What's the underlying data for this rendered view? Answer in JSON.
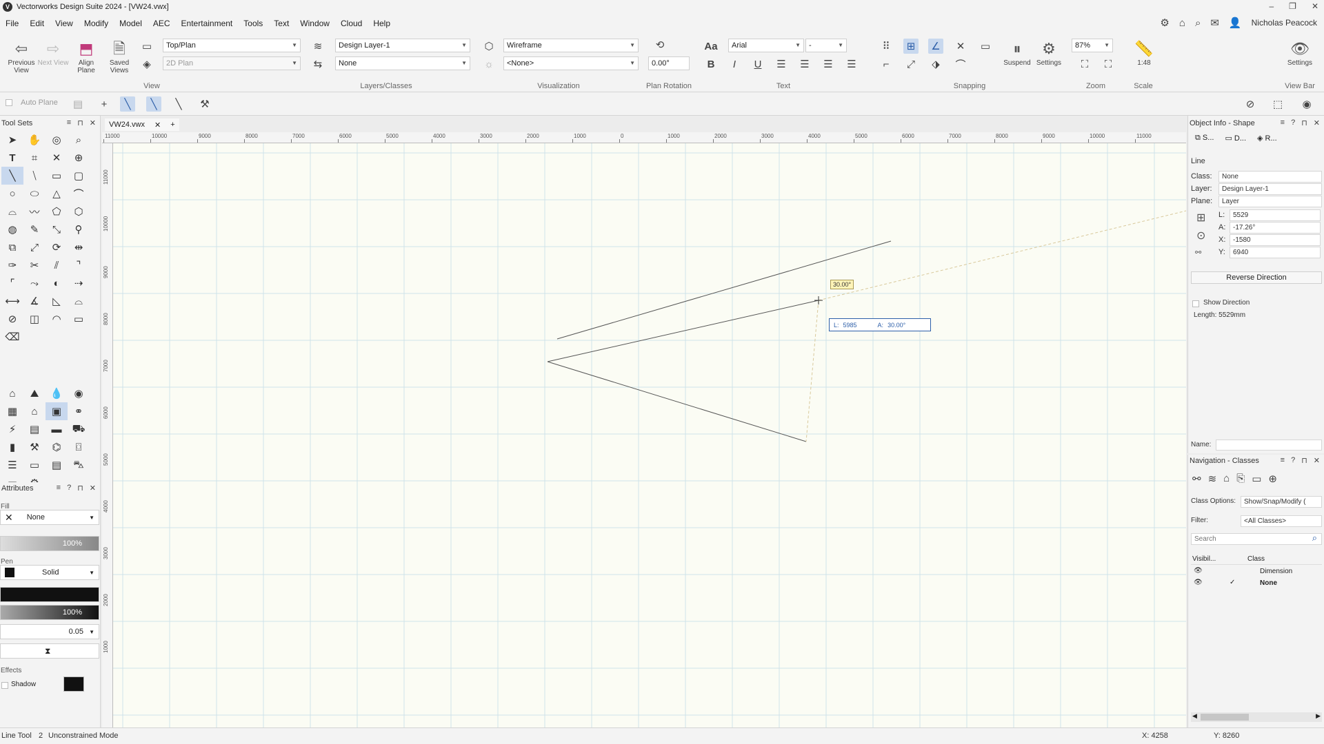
{
  "window": {
    "title": "Vectorworks Design Suite 2024 - [VW24.vwx]",
    "minimize": "–",
    "restore": "❐",
    "close": "✕"
  },
  "menu": [
    "File",
    "Edit",
    "View",
    "Modify",
    "Model",
    "AEC",
    "Entertainment",
    "Tools",
    "Text",
    "Window",
    "Cloud",
    "Help"
  ],
  "user": {
    "name": "Nicholas Peacock"
  },
  "ribbon": {
    "view": {
      "previous_view": "Previous View",
      "next_view": "Next View",
      "align_plane": "Align Plane",
      "saved_views": "Saved Views",
      "view_select": "Top/Plan",
      "render_select": "2D Plan",
      "group_label": "View"
    },
    "layers": {
      "layer_select": "Design Layer-1",
      "class_select": "None",
      "group_label": "Layers/Classes"
    },
    "visualization": {
      "render_mode": "Wireframe",
      "light_option": "<None>",
      "group_label": "Visualization"
    },
    "plan_rotation": {
      "value": "0.00°",
      "group_label": "Plan Rotation"
    },
    "text": {
      "font": "Arial",
      "size": "-",
      "group_label": "Text"
    },
    "snapping": {
      "suspend_label": "Suspend",
      "settings_label": "Settings",
      "group_label": "Snapping"
    },
    "zoom": {
      "value": "87%",
      "group_label": "Zoom"
    },
    "scale": {
      "value": "1:48",
      "group_label": "Scale"
    },
    "viewbar": {
      "settings_label": "Settings",
      "group_label": "View Bar"
    }
  },
  "modebar": {
    "auto_plane": "Auto Plane"
  },
  "toolsets": {
    "title": "Tool Sets"
  },
  "attributes": {
    "title": "Attributes",
    "fill_label": "Fill",
    "fill_value": "None",
    "fill_opacity": "100%",
    "pen_label": "Pen",
    "pen_style": "Solid",
    "pen_opacity": "100%",
    "line_weight": "0.05",
    "effects_label": "Effects",
    "shadow_label": "Shadow"
  },
  "document": {
    "tab_name": "VW24.vwx",
    "add_tab": "+"
  },
  "ruler": {
    "h_ticks": [
      "11000",
      "10000",
      "9000",
      "8000",
      "7000",
      "6000",
      "5000",
      "4000",
      "3000",
      "2000",
      "1000",
      "0",
      "1000",
      "2000",
      "3000",
      "4000",
      "5000",
      "6000",
      "7000",
      "8000",
      "9000",
      "10000",
      "11000"
    ],
    "v_ticks": [
      "11000",
      "10000",
      "9000",
      "8000",
      "7000",
      "6000",
      "5000",
      "4000",
      "3000",
      "2000",
      "1000"
    ]
  },
  "canvas": {
    "angle_tag": "30.00°",
    "length_label": "L:",
    "length_value": "5985",
    "angle_label": "A:",
    "angle_value": "30.00°"
  },
  "object_info": {
    "title": "Object Info - Shape",
    "tab_shape": "S...",
    "tab_data": "D...",
    "tab_render": "R...",
    "object_type": "Line",
    "class_label": "Class:",
    "class_value": "None",
    "layer_label": "Layer:",
    "layer_value": "Design Layer-1",
    "plane_label": "Plane:",
    "plane_value": "Layer",
    "l_label": "L:",
    "l_value": "5529",
    "a_label": "A:",
    "a_value": "-17.26°",
    "x_label": "X:",
    "x_value": "-1580",
    "y_label": "Y:",
    "y_value": "6940",
    "reverse_direction": "Reverse Direction",
    "show_direction": "Show Direction",
    "length_text": "Length: 5529mm",
    "name_label": "Name:"
  },
  "navigation": {
    "title": "Navigation - Classes",
    "class_options_label": "Class Options:",
    "class_options_value": "Show/Snap/Modify (",
    "filter_label": "Filter:",
    "filter_value": "<All Classes>",
    "search_placeholder": "Search",
    "col_visibility": "Visibil...",
    "col_class": "Class",
    "rows": [
      {
        "name": "Dimension",
        "visible": true,
        "active": false
      },
      {
        "name": "None",
        "visible": true,
        "active": true
      }
    ]
  },
  "status": {
    "tool": "Line Tool",
    "mode_num": "2",
    "mode": "Unconstrained Mode",
    "x": "X: 4258",
    "y": "Y: 8260"
  },
  "colors": {
    "canvas_bg": "#fbfcf4",
    "grid": "#cfe3ea",
    "accent": "#2c5ea8"
  }
}
